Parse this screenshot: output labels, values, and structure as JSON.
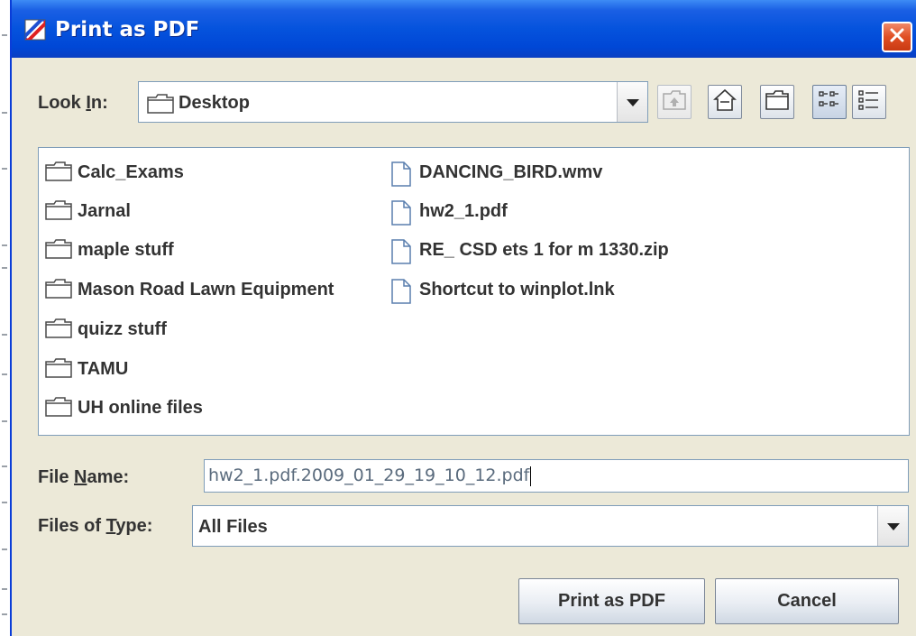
{
  "window": {
    "title": "Print as PDF",
    "title_icon": "print-pdf-app-icon",
    "close_icon": "close-icon"
  },
  "look_in": {
    "label_pre": "Look ",
    "label_mnemonic": "I",
    "label_post": "n:",
    "value": "Desktop",
    "icon": "folder-icon"
  },
  "toolbar": {
    "up_one_level": "up-folder-icon",
    "home": "home-icon",
    "new_folder": "new-folder-icon",
    "list_view": "list-view-icon",
    "details_view": "details-view-icon"
  },
  "files": {
    "column1": [
      {
        "name": "Calc_Exams",
        "type": "folder"
      },
      {
        "name": "Jarnal",
        "type": "folder"
      },
      {
        "name": "maple stuff",
        "type": "folder"
      },
      {
        "name": "Mason Road Lawn Equipment",
        "type": "folder"
      },
      {
        "name": "quizz stuff",
        "type": "folder"
      },
      {
        "name": "TAMU",
        "type": "folder"
      },
      {
        "name": "UH online files",
        "type": "folder"
      }
    ],
    "column2": [
      {
        "name": "DANCING_BIRD.wmv",
        "type": "file"
      },
      {
        "name": "hw2_1.pdf",
        "type": "file"
      },
      {
        "name": "RE_ CSD ets 1 for m 1330.zip",
        "type": "file"
      },
      {
        "name": "Shortcut to winplot.lnk",
        "type": "file"
      }
    ]
  },
  "file_name": {
    "label_pre": "File ",
    "label_mnemonic": "N",
    "label_post": "ame:",
    "value": "hw2_1.pdf.2009_01_29_19_10_12.pdf"
  },
  "file_type": {
    "label_pre": "Files of ",
    "label_mnemonic": "T",
    "label_post": "ype:",
    "value": "All Files"
  },
  "buttons": {
    "approve": "Print as PDF",
    "cancel": "Cancel"
  }
}
